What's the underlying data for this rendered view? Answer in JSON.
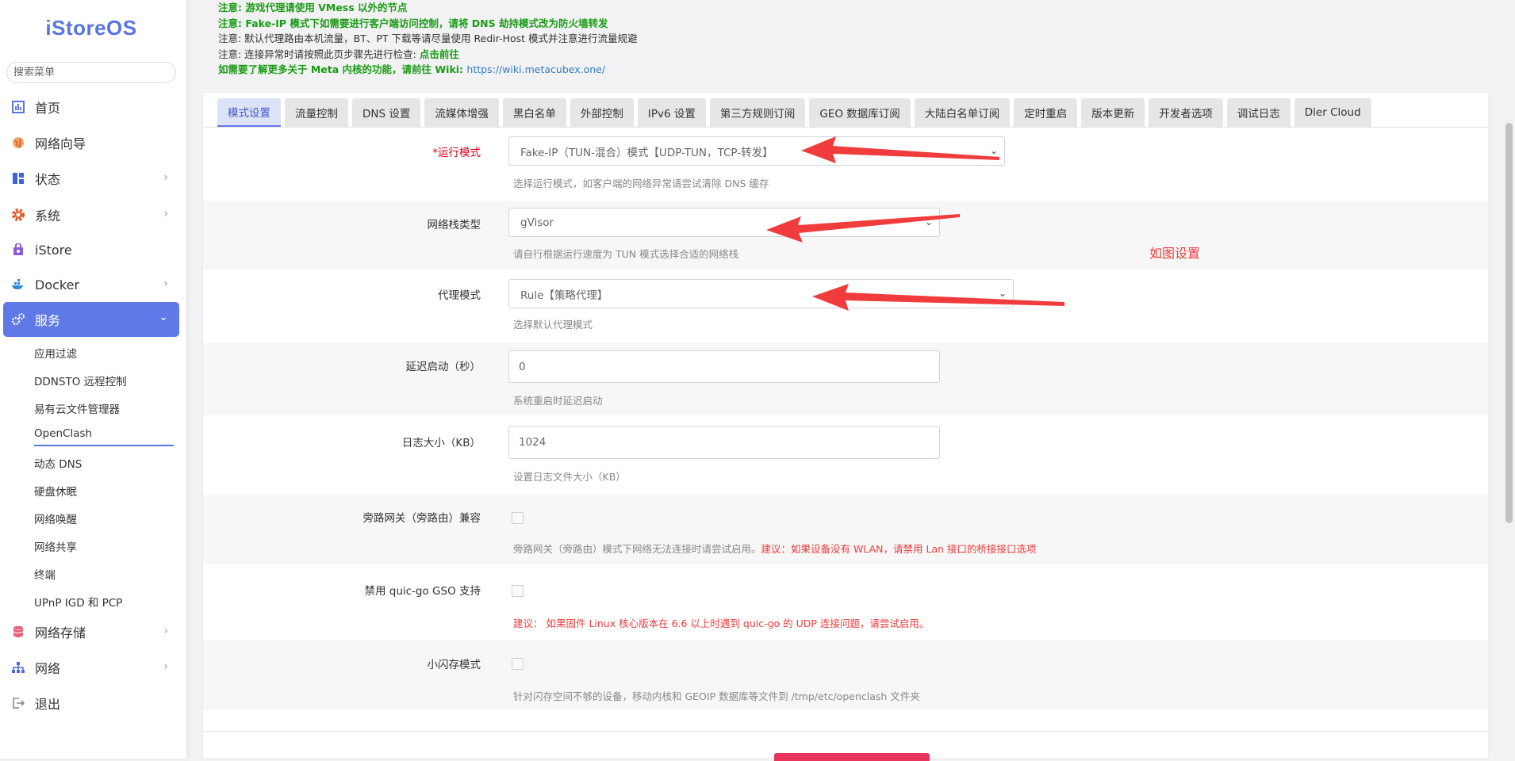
{
  "sidebar": {
    "logo": "iStoreOS",
    "search_placeholder": "搜索菜单",
    "items": [
      {
        "label": "首页",
        "icon": "dashboard-icon"
      },
      {
        "label": "网络向导",
        "icon": "globe-icon"
      },
      {
        "label": "状态",
        "icon": "grid-icon"
      },
      {
        "label": "系统",
        "icon": "gear-icon"
      },
      {
        "label": "iStore",
        "icon": "store-icon"
      },
      {
        "label": "Docker",
        "icon": "docker-icon"
      },
      {
        "label": "服务",
        "icon": "services-icon"
      },
      {
        "label": "网络存储",
        "icon": "database-icon"
      },
      {
        "label": "网络",
        "icon": "network-icon"
      },
      {
        "label": "退出",
        "icon": "logout-icon"
      }
    ],
    "sub_items": [
      "应用过滤",
      "DDNSTO 远程控制",
      "易有云文件管理器",
      "OpenClash",
      "动态 DNS",
      "硬盘休眠",
      "网络唤醒",
      "网络共享",
      "终端",
      "UPnP IGD 和 PCP"
    ]
  },
  "notices": {
    "n1": "注意: 游戏代理请使用 VMess 以外的节点",
    "n2": "注意: Fake-IP 模式下如需要进行客户端访问控制，请将 DNS 劫持模式改为防火墙转发",
    "n3": "注意: 默认代理路由本机流量，BT、PT 下载等请尽量使用 Redir-Host 模式并注意进行流量规避",
    "n4_prefix": "注意: 连接异常时请按照此页步骤先进行检查: ",
    "n4_link": "点击前往",
    "n5_prefix": "如需要了解更多关于 Meta 内核的功能，请前往 Wiki: ",
    "n5_link": "https://wiki.metacubex.one/"
  },
  "tabs": [
    "模式设置",
    "流量控制",
    "DNS 设置",
    "流媒体增强",
    "黑白名单",
    "外部控制",
    "IPv6 设置",
    "第三方规则订阅",
    "GEO 数据库订阅",
    "大陆白名单订阅",
    "定时重启",
    "版本更新",
    "开发者选项",
    "调试日志",
    "Dler Cloud"
  ],
  "form": {
    "run_mode": {
      "label": "*运行模式",
      "value": "Fake-IP（TUN-混合）模式【UDP-TUN，TCP-转发】",
      "desc": "选择运行模式，如客户端的网络异常请尝试清除 DNS 缓存"
    },
    "stack_type": {
      "label": "网络栈类型",
      "value": "gVisor",
      "desc": "请自行根据运行速度为 TUN 模式选择合适的网络栈"
    },
    "proxy_mode": {
      "label": "代理模式",
      "value": "Rule【策略代理】",
      "desc": "选择默认代理模式"
    },
    "delay_start": {
      "label": "延迟启动（秒）",
      "value": "0",
      "desc": "系统重启时延迟启动"
    },
    "log_size": {
      "label": "日志大小（KB）",
      "value": "1024",
      "desc": "设置日志文件大小（KB）"
    },
    "bypass_gateway": {
      "label": "旁路网关（旁路由）兼容",
      "desc": "旁路网关（旁路由）模式下网络无法连接时请尝试启用。",
      "warn": "建议：如果设备没有 WLAN，请禁用 Lan 接口的桥接接口选项"
    },
    "quic_gso": {
      "label": "禁用 quic-go GSO 支持",
      "warn": "建议：  如果固件 Linux 核心版本在 6.6 以上时遇到 quic-go 的 UDP 连接问题，请尝试启用。"
    },
    "small_flash": {
      "label": "小闪存模式",
      "desc": "针对闪存空间不够的设备，移动内核和 GEOIP 数据库等文件到 /tmp/etc/openclash 文件夹"
    }
  },
  "annotation": "如图设置",
  "colors": {
    "accent": "#5f79e6",
    "arrow": "#f03c3c",
    "notice_green": "#1a9b14"
  }
}
